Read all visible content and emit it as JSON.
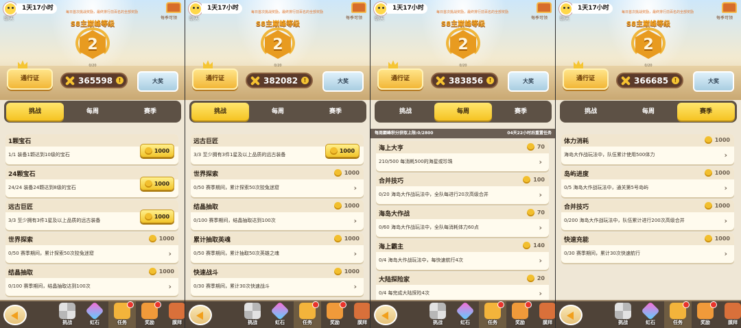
{
  "common": {
    "timer": "1天17小时",
    "avatar_label": "聊天",
    "notice": "每日首次挑战奖励，最终排行前百名的全部奖励",
    "chest_label": "每季可领",
    "season_title": "S8主巅峰等级",
    "level": "2",
    "progress": "0/20",
    "pass_button": "通行证",
    "grand_prize_button": "大奖",
    "info_icon": "!",
    "tabs": [
      "挑战",
      "每周",
      "赛季"
    ],
    "bottom_nav": [
      "挑战",
      "虹石",
      "任务",
      "奖励",
      "膜拜"
    ]
  },
  "panels": [
    {
      "score": "365598",
      "active_tab": 0,
      "tab_dot": null,
      "info_bar": null,
      "cards": [
        {
          "title": "1颗宝石",
          "desc": "1/1 装备1颗达到10级的宝石",
          "reward": "1000",
          "claimable": true
        },
        {
          "title": "24颗宝石",
          "desc": "24/24 装备24颗达到8级的宝石",
          "reward": "1000",
          "claimable": true
        },
        {
          "title": "远古巨匠",
          "desc": "3/3 至少拥有3件1星及以上品质的远古装备",
          "reward": "1000",
          "claimable": true
        },
        {
          "title": "世界探索",
          "desc": "0/50 赛季期间，累计探索50次狡兔迷窟",
          "reward": "1000",
          "claimable": false
        },
        {
          "title": "结晶抽取",
          "desc": "0/100 赛季期间，结晶抽取达到100次",
          "reward": "1000",
          "claimable": false
        }
      ]
    },
    {
      "score": "382082",
      "active_tab": 0,
      "tab_dot": null,
      "info_bar": null,
      "cards": [
        {
          "title": "远古巨匠",
          "desc": "3/3 至少拥有3件1星及以上品质的远古装备",
          "reward": "1000",
          "claimable": true
        },
        {
          "title": "世界探索",
          "desc": "0/50 赛季期间，累计探索50次狡兔迷窟",
          "reward": "1000",
          "claimable": false
        },
        {
          "title": "结晶抽取",
          "desc": "0/100 赛季期间，结晶抽取达到100次",
          "reward": "1000",
          "claimable": false
        },
        {
          "title": "累计抽取英魂",
          "desc": "0/50 赛季期间，累计抽取50次英雄之魂",
          "reward": "1000",
          "claimable": false
        },
        {
          "title": "快速战斗",
          "desc": "0/30 赛季期间，累计30次快速战斗",
          "reward": "1000",
          "claimable": false
        }
      ]
    },
    {
      "score": "383856",
      "active_tab": 1,
      "tab_dot": 1,
      "info_bar": {
        "left": "每周巅峰积分获取上限:0/2800",
        "right": "04天22小时后重置任务"
      },
      "cards": [
        {
          "title": "海上大亨",
          "desc": "210/500 每消耗500的海星或珍珠",
          "reward": "70",
          "claimable": false
        },
        {
          "title": "合并技巧",
          "desc": "0/20 海岛大作战玩法中，全队每进行20次高级合并",
          "reward": "100",
          "claimable": false
        },
        {
          "title": "海岛大作战",
          "desc": "0/60 海岛大作战玩法中，全队每消耗体力60点",
          "reward": "70",
          "claimable": false
        },
        {
          "title": "海上霸主",
          "desc": "0/4 海岛大作战玩法中，每快速航行4次",
          "reward": "140",
          "claimable": false
        },
        {
          "title": "大陆探险家",
          "desc": "0/4 每完成大陆探险4次",
          "reward": "20",
          "claimable": false
        }
      ]
    },
    {
      "score": "366685",
      "active_tab": 2,
      "tab_dot": 1,
      "info_bar": null,
      "cards": [
        {
          "title": "体力消耗",
          "desc": "海岛大作战玩法中，队伍累计使用500体力",
          "reward": "1000",
          "claimable": false
        },
        {
          "title": "岛屿进度",
          "desc": "0/5 海岛大作战玩法中，通关第5号岛屿",
          "reward": "1000",
          "claimable": false
        },
        {
          "title": "合并技巧",
          "desc": "0/200 海岛大作战玩法中，队伍累计进行200次高级合并",
          "reward": "1000",
          "claimable": false
        },
        {
          "title": "快速充能",
          "desc": "0/30 赛季期间，累计30次快速航行",
          "reward": "1000",
          "claimable": false
        }
      ]
    }
  ]
}
